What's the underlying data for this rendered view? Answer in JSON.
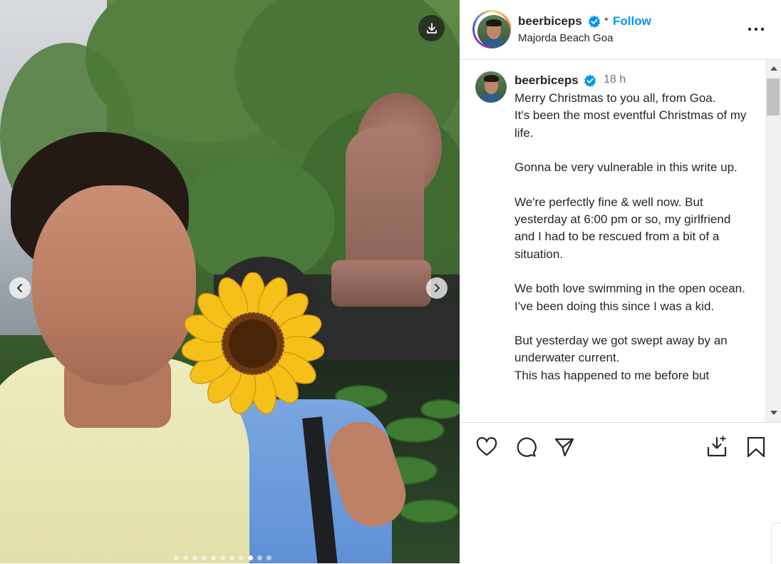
{
  "post": {
    "username": "beerbiceps",
    "separator": "•",
    "follow_label": "Follow",
    "location": "Majorda Beach Goa",
    "time_ago": "18 h",
    "caption": "Merry Christmas to you all, from Goa.\nIt's been the most eventful Christmas of my life.\n\nGonna be very vulnerable in this write up.\n\nWe're perfectly fine & well now. But yesterday at 6:00 pm or so, my girlfriend and I had to be rescued from a bit of a situation.\n\nWe both love swimming in the open ocean. I've been doing this since I was a kid.\n\nBut yesterday we got swept away by an underwater current.\nThis has happened to me before but"
  },
  "carousel": {
    "total_slides": 11,
    "active_index": 9
  },
  "icons": {
    "download": "download-icon",
    "prev": "chevron-left-icon",
    "next": "chevron-right-icon",
    "verified": "verified-badge-icon",
    "more": "more-horizontal-icon",
    "like": "heart-icon",
    "comment": "comment-icon",
    "share": "paper-plane-icon",
    "save_to": "download-tray-icon",
    "bookmark": "bookmark-icon"
  },
  "colors": {
    "link_blue": "#0095f6",
    "verified_blue": "#0095f6",
    "text": "#262626",
    "muted": "#737373"
  }
}
